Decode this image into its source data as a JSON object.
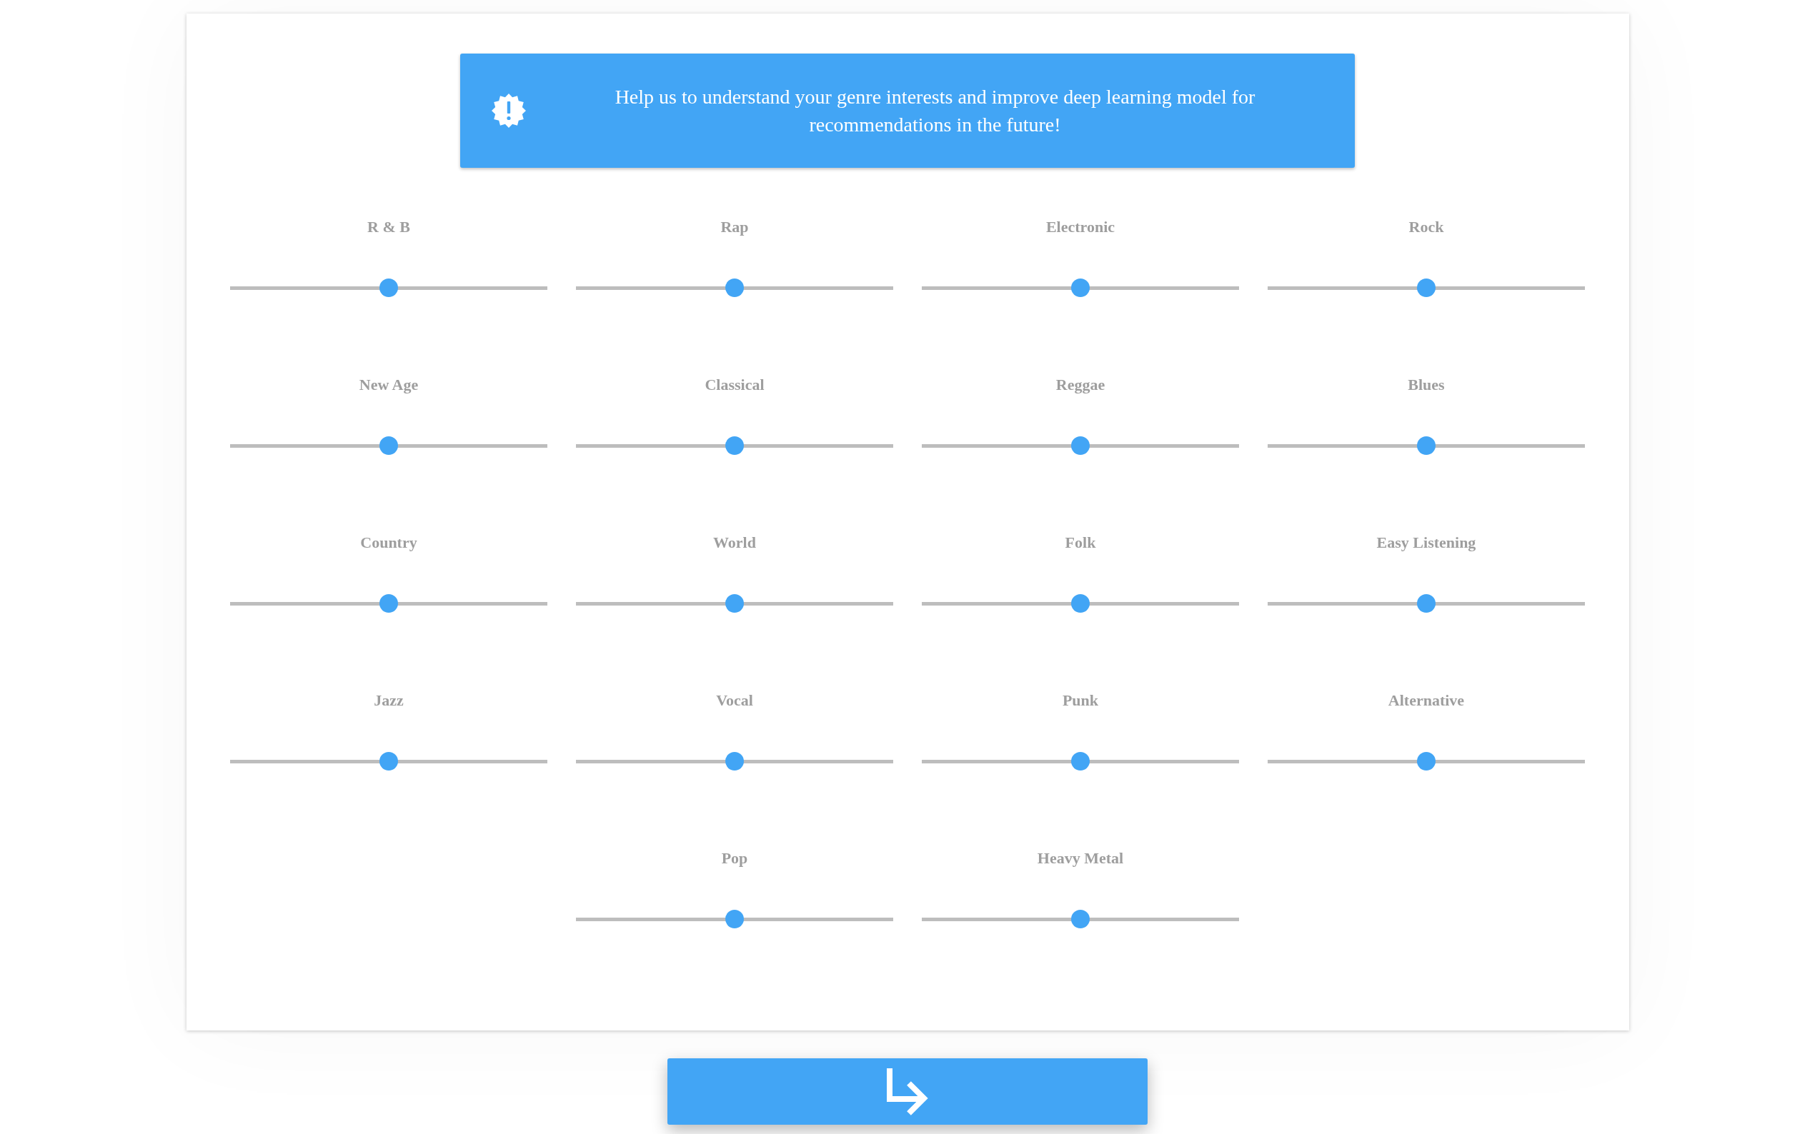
{
  "banner": {
    "message": "Help us to understand your genre interests and improve deep learning model for recommendations in the future!"
  },
  "genres": [
    {
      "label": "R & B",
      "level": 0.5
    },
    {
      "label": "Rap",
      "level": 0.5
    },
    {
      "label": "Electronic",
      "level": 0.5
    },
    {
      "label": "Rock",
      "level": 0.5
    },
    {
      "label": "New Age",
      "level": 0.5
    },
    {
      "label": "Classical",
      "level": 0.5
    },
    {
      "label": "Reggae",
      "level": 0.5
    },
    {
      "label": "Blues",
      "level": 0.5
    },
    {
      "label": "Country",
      "level": 0.5
    },
    {
      "label": "World",
      "level": 0.5
    },
    {
      "label": "Folk",
      "level": 0.5
    },
    {
      "label": "Easy Listening",
      "level": 0.5
    },
    {
      "label": "Jazz",
      "level": 0.5
    },
    {
      "label": "Vocal",
      "level": 0.5
    },
    {
      "label": "Punk",
      "level": 0.5
    },
    {
      "label": "Alternative",
      "level": 0.5
    },
    {
      "label": "Pop",
      "level": 0.5
    },
    {
      "label": "Heavy Metal",
      "level": 0.5
    }
  ]
}
